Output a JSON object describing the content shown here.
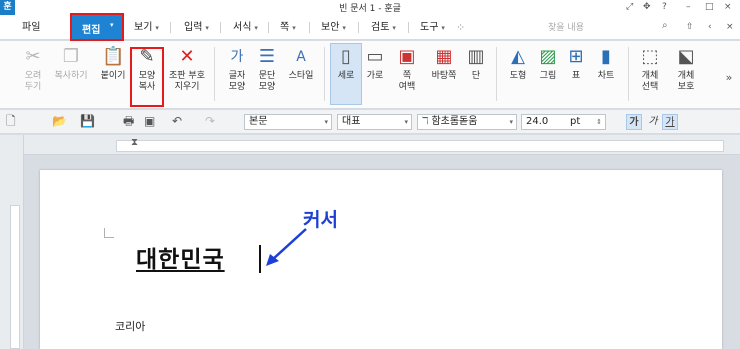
{
  "window": {
    "title": "빈 문서 1 - 훈글",
    "app_logo": "훈",
    "controls": [
      "⤢",
      "✥",
      "?",
      "–",
      "□",
      "×"
    ]
  },
  "menubar": {
    "items": [
      {
        "label": "파일",
        "caret": ""
      },
      {
        "label": "편집",
        "caret": "▾",
        "active": true
      },
      {
        "label": "보기",
        "caret": "▾"
      },
      {
        "label": "입력",
        "caret": "▾"
      },
      {
        "label": "서식",
        "caret": "▾"
      },
      {
        "label": "쪽",
        "caret": "▾"
      },
      {
        "label": "보안",
        "caret": "▾"
      },
      {
        "label": "검토",
        "caret": "▾"
      },
      {
        "label": "도구",
        "caret": "▾"
      }
    ],
    "search_placeholder": "찾을 내용",
    "right_icons": [
      "⇧",
      "‹",
      "×"
    ]
  },
  "ribbon": {
    "buttons": [
      {
        "label1": "오려",
        "label2": "두기",
        "icon": "scissors-icon",
        "disabled": true
      },
      {
        "label1": "복사하기",
        "label2": "",
        "icon": "copy-icon",
        "disabled": true
      },
      {
        "label1": "붙이기",
        "label2": "",
        "icon": "paste-icon",
        "disabled": false
      },
      {
        "label1": "모양",
        "label2": "복사",
        "icon": "format-painter-icon",
        "disabled": false,
        "highlighted": true
      },
      {
        "label1": "조판 부호",
        "label2": "지우기",
        "icon": "clear-codes-icon",
        "disabled": false
      },
      {
        "label1": "글자",
        "label2": "모양",
        "icon": "char-shape-icon",
        "disabled": false
      },
      {
        "label1": "문단",
        "label2": "모양",
        "icon": "para-shape-icon",
        "disabled": false
      },
      {
        "label1": "스타일",
        "label2": "",
        "icon": "style-icon",
        "disabled": false
      },
      {
        "label1": "세로",
        "label2": "",
        "icon": "portrait-icon",
        "disabled": false,
        "selected": true
      },
      {
        "label1": "가로",
        "label2": "",
        "icon": "landscape-icon",
        "disabled": false
      },
      {
        "label1": "쪽",
        "label2": "여백",
        "icon": "page-margin-icon",
        "disabled": false
      },
      {
        "label1": "바탕쪽",
        "label2": "",
        "icon": "master-page-icon",
        "disabled": false
      },
      {
        "label1": "단",
        "label2": "",
        "icon": "columns-icon",
        "disabled": false
      },
      {
        "label1": "도형",
        "label2": "",
        "icon": "shape-icon",
        "disabled": false
      },
      {
        "label1": "그림",
        "label2": "",
        "icon": "picture-icon",
        "disabled": false
      },
      {
        "label1": "표",
        "label2": "",
        "icon": "table-icon",
        "disabled": false
      },
      {
        "label1": "차트",
        "label2": "",
        "icon": "chart-icon",
        "disabled": false
      },
      {
        "label1": "개체",
        "label2": "선택",
        "icon": "object-select-icon",
        "disabled": false
      },
      {
        "label1": "개체",
        "label2": "보호",
        "icon": "object-protect-icon",
        "disabled": false
      }
    ],
    "more_icon": "»"
  },
  "format_toolbar": {
    "style_value": "본문",
    "language_value": "대표",
    "font_value": "함초롬돋움",
    "font_icon": "ℸ",
    "size_value": "24.0",
    "unit_value": "pt",
    "style_buttons": [
      "가",
      "가",
      "가"
    ]
  },
  "document": {
    "headline": "대한민국",
    "annotation_label": "커서",
    "body_text": "코리아"
  },
  "colors": {
    "accent": "#1e83d2",
    "highlight": "#e31b1b",
    "annotation": "#1d3fd6"
  }
}
